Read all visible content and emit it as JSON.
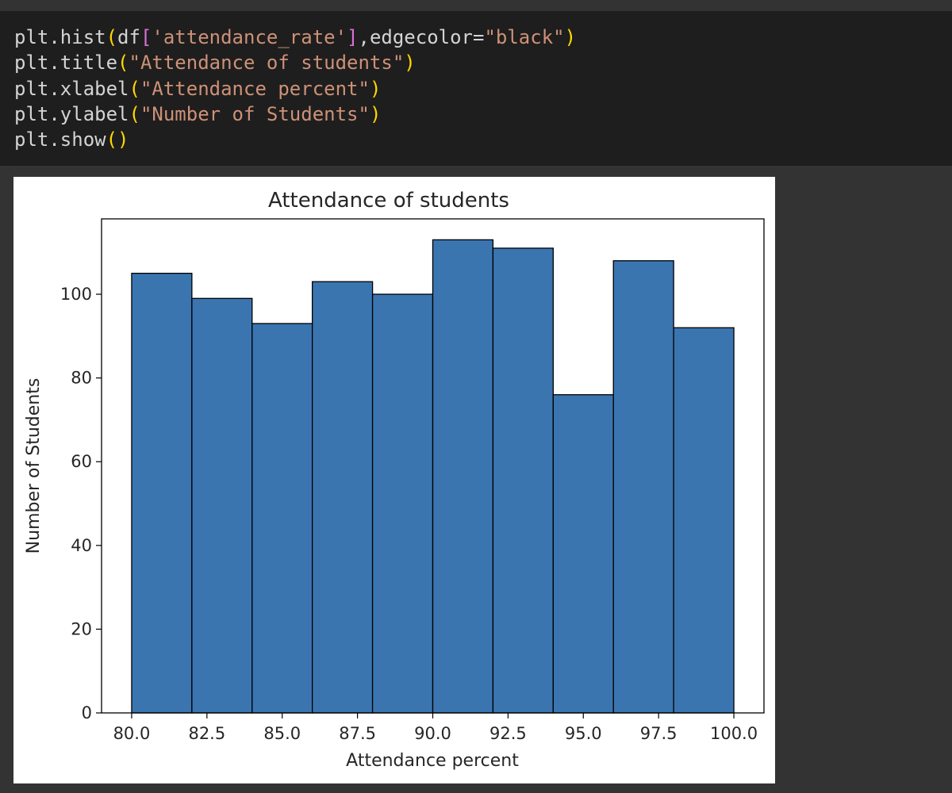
{
  "code_cell": {
    "lines": [
      [
        {
          "t": "plt.hist",
          "c": "plain"
        },
        {
          "t": "(",
          "c": "paren"
        },
        {
          "t": "df",
          "c": "plain"
        },
        {
          "t": "[",
          "c": "bracket"
        },
        {
          "t": "'attendance_rate'",
          "c": "str"
        },
        {
          "t": "]",
          "c": "bracket"
        },
        {
          "t": ",edgecolor=",
          "c": "plain"
        },
        {
          "t": "\"black\"",
          "c": "str"
        },
        {
          "t": ")",
          "c": "paren"
        }
      ],
      [
        {
          "t": "plt.title",
          "c": "plain"
        },
        {
          "t": "(",
          "c": "paren"
        },
        {
          "t": "\"Attendance of students\"",
          "c": "str"
        },
        {
          "t": ")",
          "c": "paren"
        }
      ],
      [
        {
          "t": "plt.xlabel",
          "c": "plain"
        },
        {
          "t": "(",
          "c": "paren"
        },
        {
          "t": "\"Attendance percent\"",
          "c": "str"
        },
        {
          "t": ")",
          "c": "paren"
        }
      ],
      [
        {
          "t": "plt.ylabel",
          "c": "plain"
        },
        {
          "t": "(",
          "c": "paren"
        },
        {
          "t": "\"Number of Students\"",
          "c": "str"
        },
        {
          "t": ")",
          "c": "paren"
        }
      ],
      [
        {
          "t": "plt.show",
          "c": "plain"
        },
        {
          "t": "(",
          "c": "paren"
        },
        {
          "t": ")",
          "c": "paren"
        }
      ]
    ]
  },
  "colors": {
    "bar_fill": "#3a75b0",
    "bar_edge": "#000000",
    "code_background": "#1e1e1e",
    "page_background": "#333333",
    "string": "#ce9178",
    "paren": "#ffd700",
    "bracket": "#da70d6"
  },
  "chart_data": {
    "type": "bar",
    "title": "Attendance of students",
    "xlabel": "Attendance percent",
    "ylabel": "Number of Students",
    "bin_edges": [
      80,
      82,
      84,
      86,
      88,
      90,
      92,
      94,
      96,
      98,
      100
    ],
    "values": [
      105,
      99,
      93,
      103,
      100,
      113,
      111,
      76,
      108,
      92
    ],
    "xlim": [
      79,
      101
    ],
    "ylim": [
      0,
      118
    ],
    "xticks": [
      80.0,
      82.5,
      85.0,
      87.5,
      90.0,
      92.5,
      95.0,
      97.5,
      100.0
    ],
    "xtick_labels": [
      "80.0",
      "82.5",
      "85.0",
      "87.5",
      "90.0",
      "92.5",
      "95.0",
      "97.5",
      "100.0"
    ],
    "yticks": [
      0,
      20,
      40,
      60,
      80,
      100
    ],
    "ytick_labels": [
      "0",
      "20",
      "40",
      "60",
      "80",
      "100"
    ],
    "grid": false,
    "legend": "none"
  }
}
